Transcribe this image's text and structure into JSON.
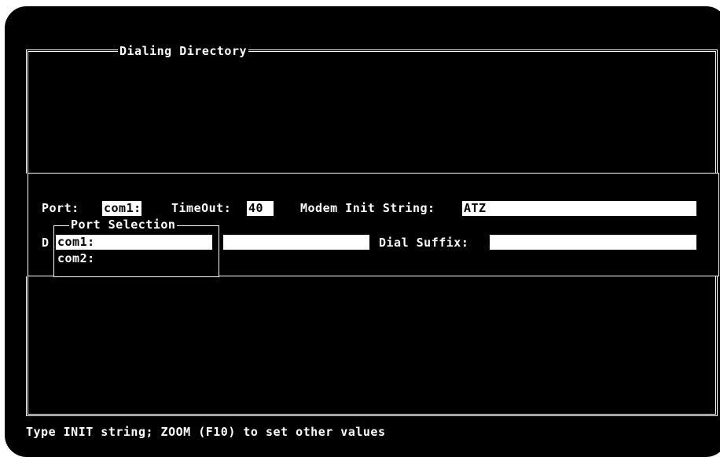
{
  "window": {
    "title": "Dialing Directory"
  },
  "modem": {
    "port_label": "Port:",
    "port_value": "com1:",
    "timeout_label": "TimeOut:",
    "timeout_value": "40",
    "init_label": "Modem Init String:",
    "init_value": "ATZ",
    "dial_prefix_letter": "D",
    "dial_prefix_value": "",
    "dial_suffix_label": "Dial Suffix:",
    "dial_suffix_value": ""
  },
  "port_selection": {
    "title": "Port Selection",
    "options": [
      "com1:",
      "com2:"
    ]
  },
  "status_bar": {
    "text": "Type INIT string; ZOOM (F10) to set other values"
  }
}
